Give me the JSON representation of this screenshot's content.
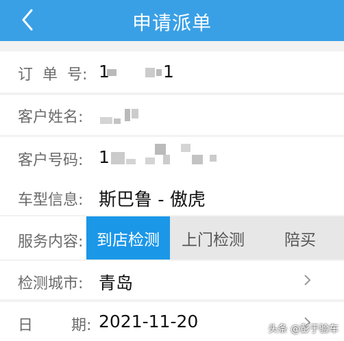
{
  "header": {
    "title": "申请派单",
    "background": "#3aa0e6"
  },
  "form": {
    "order_no": {
      "label": "订  单  号:",
      "value_prefix": "1",
      "value_suffix": "1"
    },
    "customer_name": {
      "label": "客户姓名:"
    },
    "customer_phone": {
      "label": "客户号码:",
      "value_prefix": "1"
    },
    "car_model": {
      "label": "车型信息:",
      "value": "斯巴鲁 - 傲虎"
    },
    "service": {
      "label": "服务内容:",
      "options": [
        "到店检测",
        "上门检测",
        "陪买"
      ],
      "selected": "到店检测",
      "accent": "#1b97e8"
    },
    "city": {
      "label": "检测城市:",
      "value": "青岛"
    },
    "date": {
      "label": "日        期:",
      "value": "2021-11-20"
    }
  },
  "watermark": {
    "text": "头条 @彭于验车"
  }
}
